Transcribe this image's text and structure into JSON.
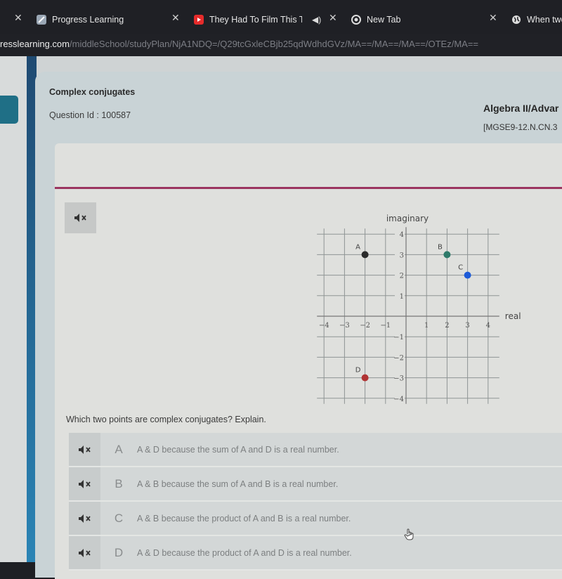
{
  "browser": {
    "tabs": [
      {
        "label": "Progress Learning",
        "icon": "progress-learning-favicon"
      },
      {
        "label": "They Had To Film This Te",
        "icon": "youtube-favicon",
        "audio_icon": "speaker-playing-icon"
      },
      {
        "label": "New Tab",
        "icon": "chrome-favicon"
      },
      {
        "label": "When two",
        "icon": "globe-favicon"
      }
    ],
    "url_host": "resslearning.com",
    "url_path": "/middleSchool/studyPlan/NjA1NDQ=/Q29tcGxleCBjb25qdWdhdGVz/MA==/MA==/MA==/OTEz/MA=="
  },
  "header": {
    "title": "Complex conjugates",
    "question_id": "Question Id : 100587",
    "subject": "Algebra II/Advar",
    "standard": "[MGSE9-12.N.CN.3"
  },
  "colors": {
    "accent_line": "#9b3560",
    "point_A": "#2b2b2b",
    "point_B": "#2e7a6a",
    "point_C": "#1d5bd8",
    "point_D": "#b03333"
  },
  "chart_data": {
    "type": "scatter",
    "title": "",
    "xlabel": "real",
    "ylabel": "imaginary",
    "xlim": [
      -4,
      4
    ],
    "ylim": [
      -4,
      4
    ],
    "grid": true,
    "x_ticks": [
      "-4",
      "-3",
      "-2",
      "-1",
      "1",
      "2",
      "3",
      "4"
    ],
    "y_ticks": [
      "4",
      "3",
      "2",
      "1",
      "-1",
      "-2",
      "-3",
      "-4"
    ],
    "points": [
      {
        "label": "A",
        "x": -2,
        "y": 3
      },
      {
        "label": "B",
        "x": 2,
        "y": 3
      },
      {
        "label": "C",
        "x": 3,
        "y": 2
      },
      {
        "label": "D",
        "x": -2,
        "y": -3
      }
    ]
  },
  "question": {
    "prompt": "Which two points are complex conjugates? Explain.",
    "options": [
      {
        "letter": "A",
        "text": "A & D because the sum of A and D is a real number."
      },
      {
        "letter": "B",
        "text": "A & B because the sum of A and B is a real number."
      },
      {
        "letter": "C",
        "text": "A & B because the product of A and B is a real number."
      },
      {
        "letter": "D",
        "text": "A & D because the product of A and D is a real number."
      }
    ]
  }
}
